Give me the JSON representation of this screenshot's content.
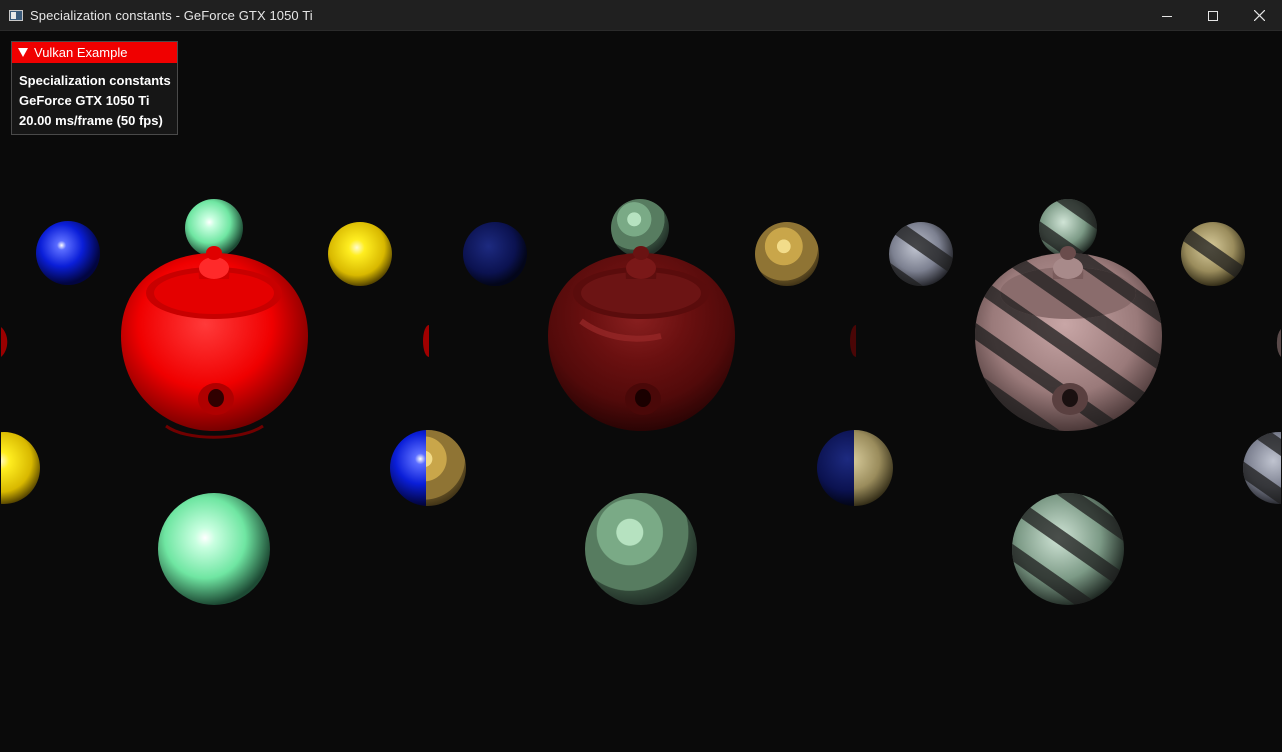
{
  "window": {
    "title": "Specialization constants - GeForce GTX 1050 Ti",
    "controls": {
      "minimize": "—",
      "maximize": "☐",
      "close": "✕"
    }
  },
  "overlay": {
    "header": "Vulkan Example",
    "lines": [
      "Specialization constants",
      "GeForce GTX 1050 Ti",
      "20.00 ms/frame (50 fps)"
    ],
    "accent": "#f00000"
  },
  "scene": {
    "background": "#0a0a0a",
    "panels": [
      {
        "name": "phong",
        "teapot_color": "#ff1a1a"
      },
      {
        "name": "toon",
        "teapot_color": "#7a1010"
      },
      {
        "name": "textured",
        "teapot_color": "#8a6a6a"
      }
    ]
  }
}
